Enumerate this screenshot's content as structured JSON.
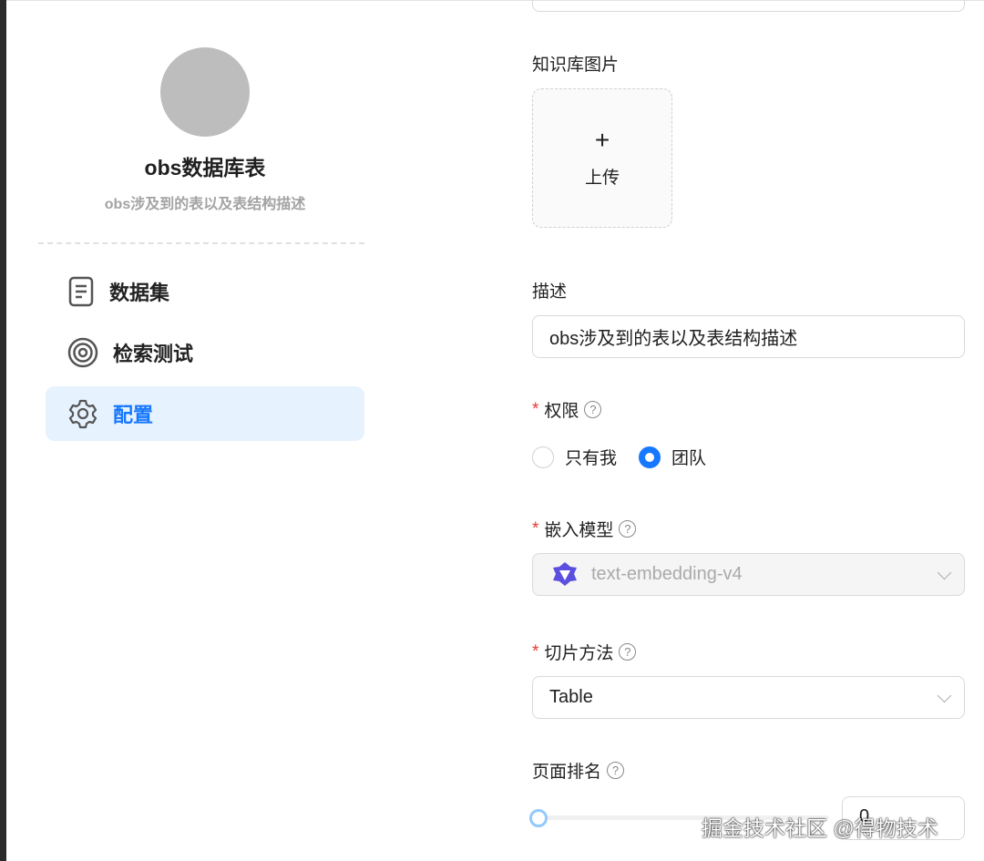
{
  "knowledge_base": {
    "name": "obs数据库表",
    "description": "obs涉及到的表以及表结构描述"
  },
  "nav": [
    {
      "label": "数据集",
      "icon": "document-icon"
    },
    {
      "label": "检索测试",
      "icon": "target-icon"
    },
    {
      "label": "配置",
      "icon": "gear-icon",
      "active": true
    }
  ],
  "form": {
    "image_label": "知识库图片",
    "upload_plus": "+",
    "upload_label": "上传",
    "desc_label": "描述",
    "desc_value": "obs涉及到的表以及表结构描述",
    "perm_label": "权限",
    "perm_options": [
      "只有我",
      "团队"
    ],
    "perm_selected": "团队",
    "embed_label": "嵌入模型",
    "embed_value": "text-embedding-v4",
    "chunk_label": "切片方法",
    "chunk_value": "Table",
    "rank_label": "页面排名",
    "rank_value": "0",
    "help": "?",
    "required": "*"
  },
  "accent": "#1677ff",
  "watermark": "掘金技术社区 @得物技术"
}
